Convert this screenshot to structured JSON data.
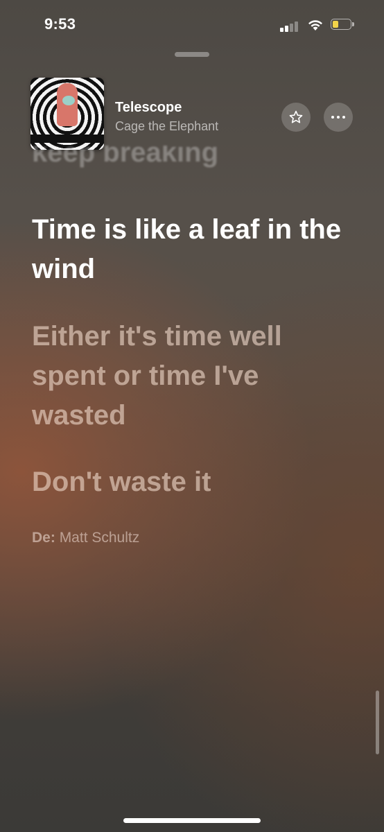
{
  "status_bar": {
    "time": "9:53",
    "battery_level": 0.35,
    "battery_color": "#f2d34a"
  },
  "now_playing": {
    "title": "Telescope",
    "artist": "Cage the Elephant",
    "favorite_icon": "star-icon",
    "more_icon": "ellipsis-icon"
  },
  "lyrics": {
    "previous_line": "keep breaking",
    "current_line": "Time is like a leaf in the wind",
    "next_lines": [
      "Either it's time well spent or time I've wasted",
      "Don't waste it"
    ],
    "credit_prefix": "De:",
    "credit_name": "Matt Schultz"
  },
  "colors": {
    "background_top": "#4d4944",
    "accent_warm": "#96563a",
    "current_lyric": "#ffffff"
  }
}
